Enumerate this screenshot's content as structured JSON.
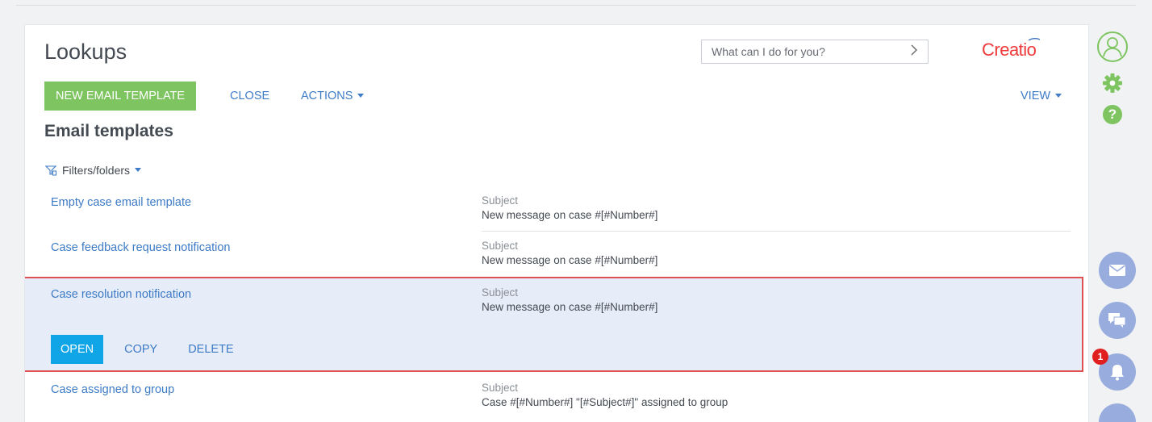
{
  "header": {
    "title": "Lookups",
    "search_placeholder": "What can I do for you?",
    "logo_text": "Creatio"
  },
  "toolbar": {
    "new_label": "NEW EMAIL TEMPLATE",
    "close_label": "CLOSE",
    "actions_label": "ACTIONS",
    "view_label": "VIEW"
  },
  "section": {
    "title": "Email templates",
    "filters_label": "Filters/folders"
  },
  "rows": [
    {
      "name": "Empty case email template",
      "col_label": "Subject",
      "col_value": "New message on case #[#Number#]"
    },
    {
      "name": "Case feedback request notification",
      "col_label": "Subject",
      "col_value": "New message on case #[#Number#]"
    },
    {
      "name": "Case resolution notification",
      "col_label": "Subject",
      "col_value": "New message on case #[#Number#]"
    },
    {
      "name": "Case assigned to group",
      "col_label": "Subject",
      "col_value": "Case #[#Number#] \"[#Subject#]\" assigned to group"
    }
  ],
  "row_actions": {
    "open_label": "OPEN",
    "copy_label": "COPY",
    "delete_label": "DELETE"
  },
  "sidebar": {
    "notification_count": "1"
  },
  "colors": {
    "accent_green": "#7ec460",
    "open_blue": "#10a5e6",
    "link_blue": "#3d7bc6",
    "logo_red": "#ee3a3a",
    "selected_bg": "#e6ecf8",
    "selected_border": "#e05050",
    "sidebar_icon_green": "#7ec460",
    "sidebar_circle": "#98addd"
  },
  "icons": {
    "profile": "user-circle-icon",
    "settings": "gear-icon",
    "help": "question-icon",
    "email": "envelope-icon",
    "chat": "chat-icon",
    "notifications": "bell-icon"
  }
}
